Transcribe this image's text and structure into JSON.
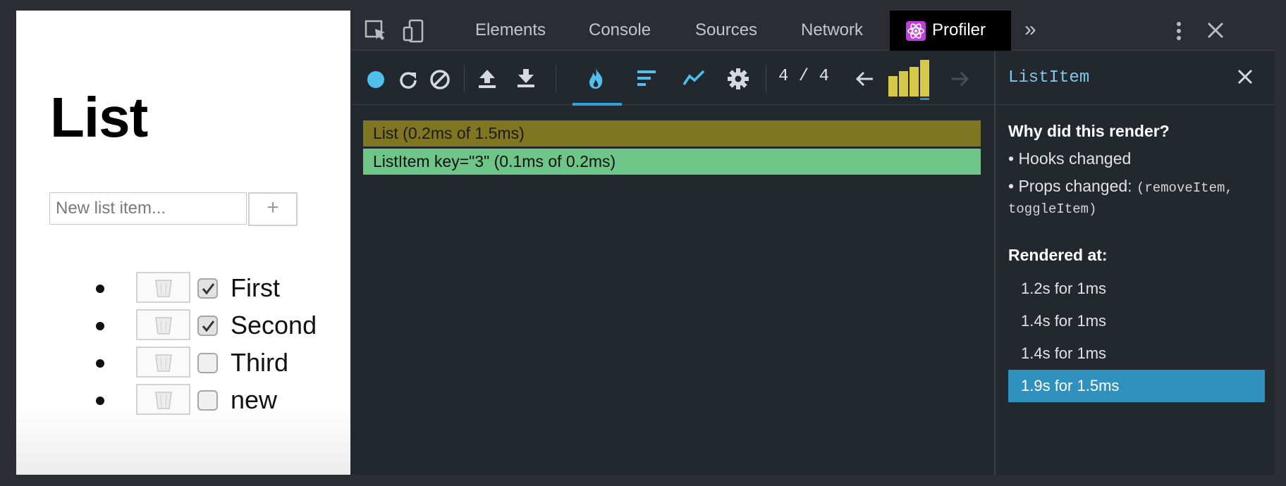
{
  "app": {
    "title": "List",
    "input_placeholder": "New list item...",
    "add_label": "+",
    "items": [
      {
        "label": "First",
        "checked": true
      },
      {
        "label": "Second",
        "checked": true
      },
      {
        "label": "Third",
        "checked": false
      },
      {
        "label": "new",
        "checked": false
      }
    ]
  },
  "devtools": {
    "tabs": [
      "Elements",
      "Console",
      "Sources",
      "Network"
    ],
    "active_tab": "Profiler",
    "overflow_label": "»",
    "icons": [
      "inspect-element-icon",
      "device-toggle-icon",
      "more-vert-icon",
      "close-icon"
    ]
  },
  "profiler": {
    "commit_counter": "4 / 4",
    "commit_bars": [
      0.55,
      0.7,
      0.8,
      1.0
    ],
    "toolbar_icons": [
      "record-icon",
      "reload-icon",
      "clear-icon",
      "upload-icon",
      "download-icon",
      "flamegraph-icon",
      "ranked-icon",
      "timeline-icon",
      "settings-icon",
      "prev-commit-icon",
      "next-commit-icon"
    ],
    "flame_rows": [
      {
        "label": "List (0.2ms of 1.5ms)",
        "color": "#807521",
        "text_color": "#1b1b1b"
      },
      {
        "label": "ListItem key=\"3\" (0.1ms of 0.2ms)",
        "color": "#6dc588",
        "text_color": "#111111"
      }
    ]
  },
  "sidebar": {
    "component": "ListItem",
    "why_heading": "Why did this render?",
    "hooks_changed": "• Hooks changed",
    "props_changed_label": "• Props changed:",
    "props_changed_line1": "(removeItem,",
    "props_changed_line2": "toggleItem)",
    "rendered_at_heading": "Rendered at:",
    "renders": [
      {
        "label": "1.2s for 1ms",
        "selected": false
      },
      {
        "label": "1.4s for 1ms",
        "selected": false
      },
      {
        "label": "1.4s for 1ms",
        "selected": false
      },
      {
        "label": "1.9s for 1.5ms",
        "selected": true
      }
    ]
  },
  "colors": {
    "accent": "#2e91be",
    "commit_bar": "#d6c849",
    "component_name": "#7fc8ea"
  }
}
